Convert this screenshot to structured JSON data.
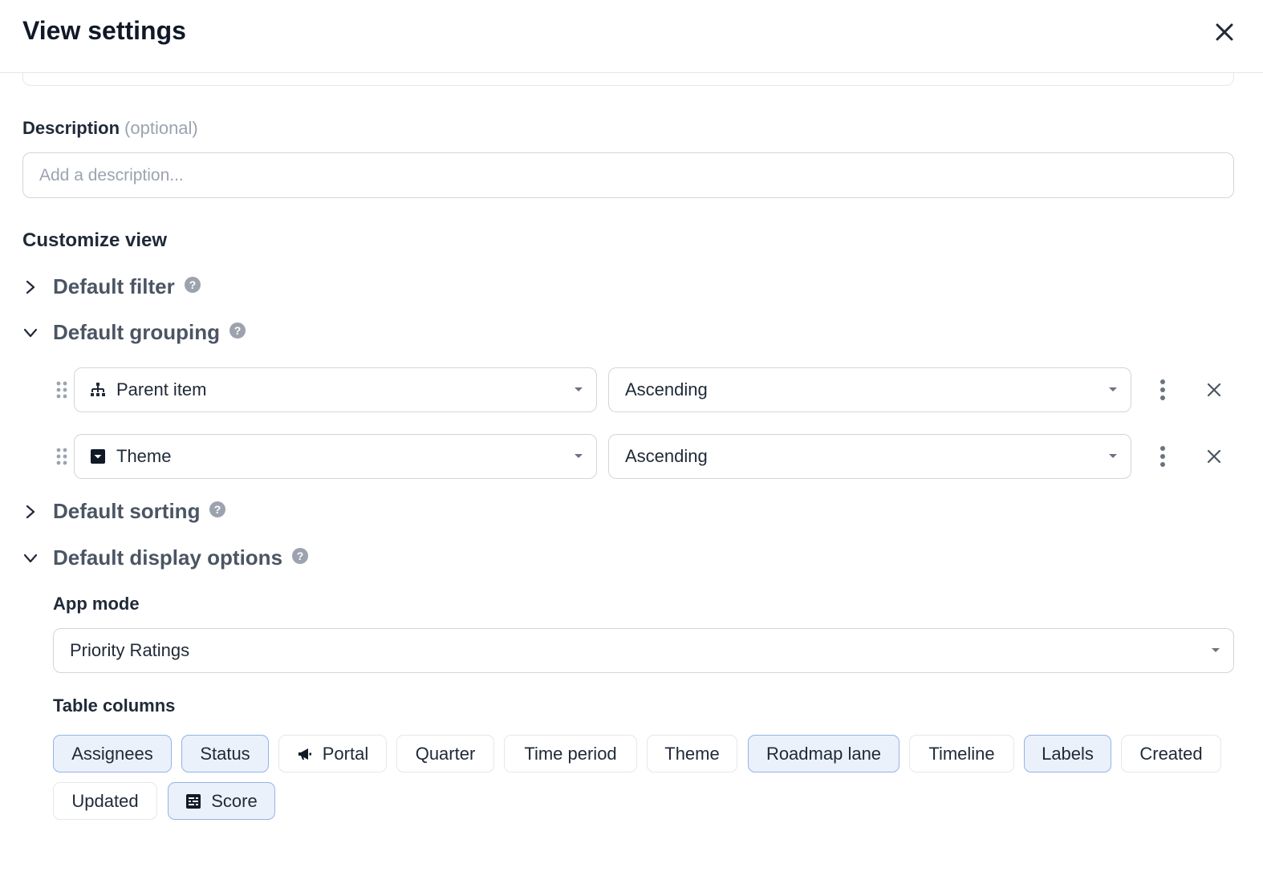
{
  "dialog": {
    "title": "View settings"
  },
  "description": {
    "label": "Description",
    "optional_text": "(optional)",
    "placeholder": "Add a description..."
  },
  "customize": {
    "title": "Customize view",
    "sections": {
      "filter": {
        "label": "Default filter",
        "expanded": false
      },
      "grouping": {
        "label": "Default grouping",
        "expanded": true
      },
      "sorting": {
        "label": "Default sorting",
        "expanded": false
      },
      "display": {
        "label": "Default display options",
        "expanded": true
      }
    }
  },
  "grouping_rows": [
    {
      "field": "Parent item",
      "field_icon": "hierarchy-icon",
      "order": "Ascending"
    },
    {
      "field": "Theme",
      "field_icon": "dropdown-field-icon",
      "order": "Ascending"
    }
  ],
  "display_options": {
    "app_mode_label": "App mode",
    "app_mode_value": "Priority Ratings",
    "table_columns_label": "Table columns",
    "columns": [
      {
        "label": "Assignees",
        "selected": true
      },
      {
        "label": "Status",
        "selected": true
      },
      {
        "label": "Portal",
        "selected": false,
        "icon": "megaphone-icon"
      },
      {
        "label": "Quarter",
        "selected": false
      },
      {
        "label": "Time period",
        "selected": false
      },
      {
        "label": "Theme",
        "selected": false
      },
      {
        "label": "Roadmap lane",
        "selected": true
      },
      {
        "label": "Timeline",
        "selected": false
      },
      {
        "label": "Labels",
        "selected": true
      },
      {
        "label": "Created",
        "selected": false
      },
      {
        "label": "Updated",
        "selected": false
      },
      {
        "label": "Score",
        "selected": true,
        "icon": "score-field-icon"
      }
    ]
  },
  "colors": {
    "chip_selected_bg": "#eaf1fb",
    "chip_selected_border": "#93b4e6",
    "text_dark": "#111827",
    "text_muted": "#4b5563"
  }
}
